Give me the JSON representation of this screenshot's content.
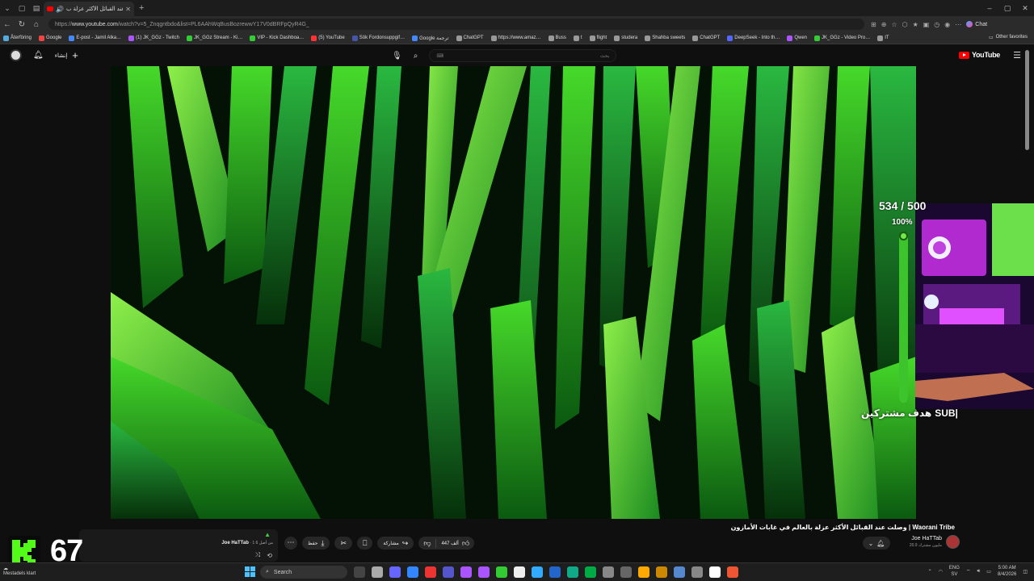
{
  "browser": {
    "tab_title": "وصلت عند القبائل الأكثر عزلة ب",
    "url_prefix": "https://",
    "url_host": "www.youtube.com",
    "url_path": "/watch?v=5_Znqgntbdo&list=PL6AAhWqBusBozrewwY17V0dBRFpQyR4G_",
    "chat_label": "Chat"
  },
  "bookmarks": [
    "Återföring",
    "Google",
    "E-post - Jamil Alka…",
    "(1) JK_GGz - Twitch",
    "JK_GGz Stream - Ki…",
    "VIP - Kick Dashboa…",
    "(5) YouTube",
    "Sök Fordonsuppgif…",
    "Google ترجمة",
    "ChatGPT",
    "https://www.amaz…",
    "Buss",
    "t",
    "flight",
    "studera",
    "Shahba sweets",
    "ChatGPT",
    "DeepSeek - Into th…",
    "Qwen",
    "JK_GGz - Video Pro…",
    "IT"
  ],
  "other_favorites": "Other favorites",
  "youtube": {
    "create_label": "إنشاء",
    "search_placeholder": "بحث",
    "logo_text": "YouTube",
    "logo_region": "SE"
  },
  "overlay": {
    "sub_count": "534 / 500",
    "sub_percent": "100%",
    "sub_fill_fraction": 1.0,
    "goal_label": "هدف مشتركين",
    "goal_suffix": "SUB|"
  },
  "video": {
    "title": "وصلت عند القبائل الأكثر عزلة بالعالم في غابات الأمازون | Waorani Tribe",
    "channel_name": "Joe HaTTab",
    "channel_subs": "20.9 مليون مشترك",
    "like_count": "447 ألف",
    "share_label": "مشاركة",
    "save_label": "حفظ"
  },
  "miniplayer": {
    "channel": "Joe HaTTab",
    "position": "1 من أصل 6"
  },
  "kick": {
    "count": "67",
    "status": "Mestadels klart"
  },
  "taskbar": {
    "search_placeholder": "Search",
    "lang_top": "ENG",
    "lang_bottom": "SV",
    "time": "5:00 AM",
    "date": "8/4/2026"
  }
}
